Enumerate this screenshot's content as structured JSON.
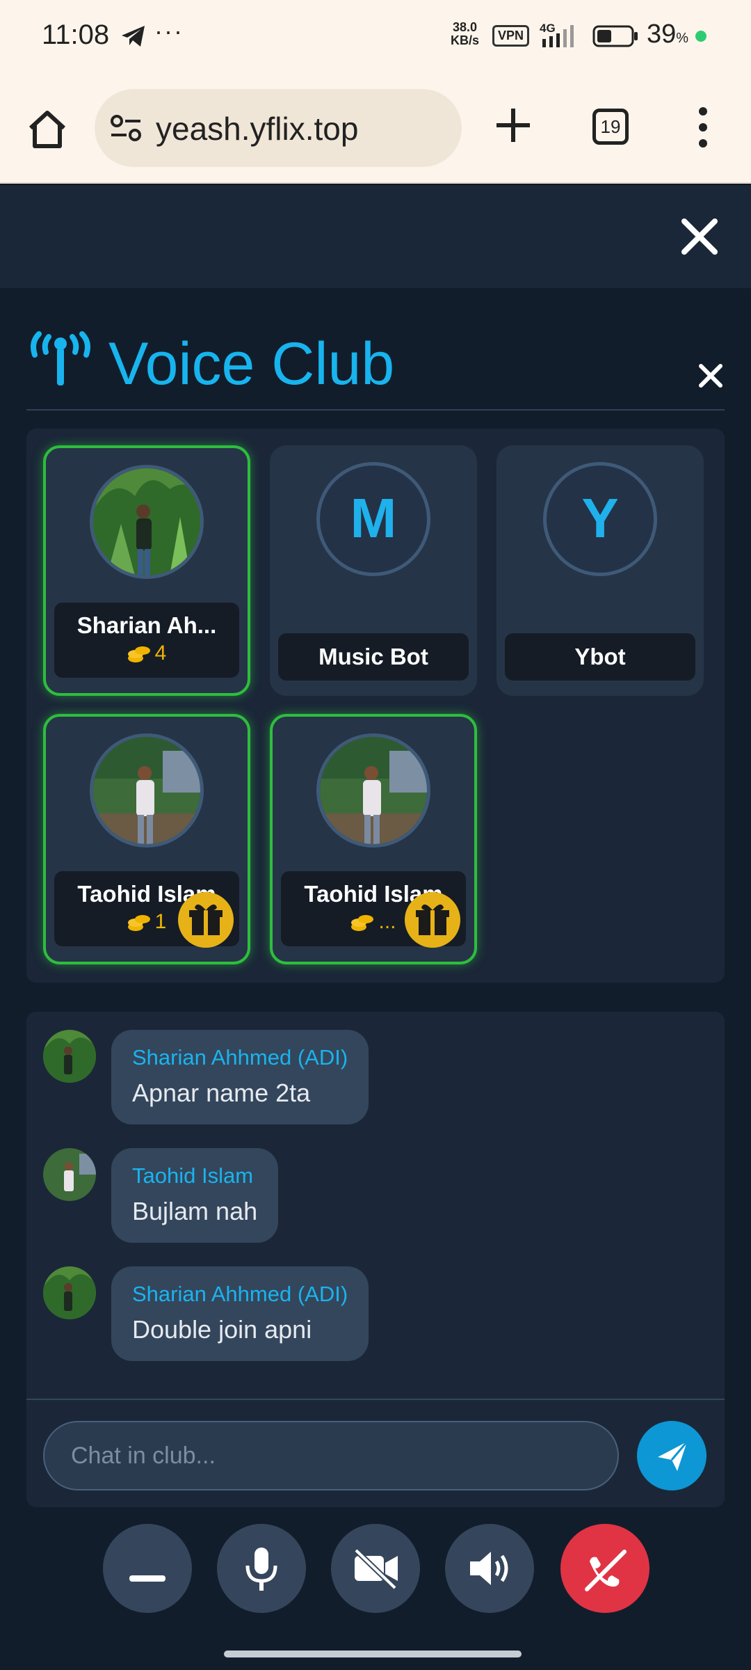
{
  "status_bar": {
    "time": "11:08",
    "dots": "···",
    "speed_top": "38.0",
    "speed_bottom": "KB/s",
    "vpn": "VPN",
    "network": "4G",
    "battery_percent": "39",
    "percent_sign": "%"
  },
  "browser": {
    "url": "yeash.yflix.top",
    "tab_count": "19"
  },
  "club": {
    "title": "Voice Club"
  },
  "participants": [
    {
      "name": "Sharian Ah...",
      "coins": "4",
      "avatar": "photo-green",
      "active": true,
      "gift": false
    },
    {
      "name": "Music Bot",
      "letter": "M",
      "active": false
    },
    {
      "name": "Ybot",
      "letter": "Y",
      "active": false
    },
    {
      "name": "Taohid Islam",
      "coins": "1",
      "avatar": "photo-street",
      "active": true,
      "gift": true
    },
    {
      "name": "Taohid Islam",
      "coins": "...",
      "avatar": "photo-street",
      "active": true,
      "gift": true
    }
  ],
  "messages": [
    {
      "sender": "Sharian Ahhmed (ADI)",
      "text": "Apnar name 2ta"
    },
    {
      "sender": "Taohid Islam",
      "text": "Bujlam nah"
    },
    {
      "sender": "Sharian Ahhmed (ADI)",
      "text": "Double join apni"
    }
  ],
  "chat": {
    "placeholder": "Chat in club..."
  },
  "colors": {
    "accent": "#18b4ee",
    "active_border": "#2ebd3e",
    "coin": "#f0b400",
    "gift": "#e6b217",
    "hangup": "#e03444"
  }
}
